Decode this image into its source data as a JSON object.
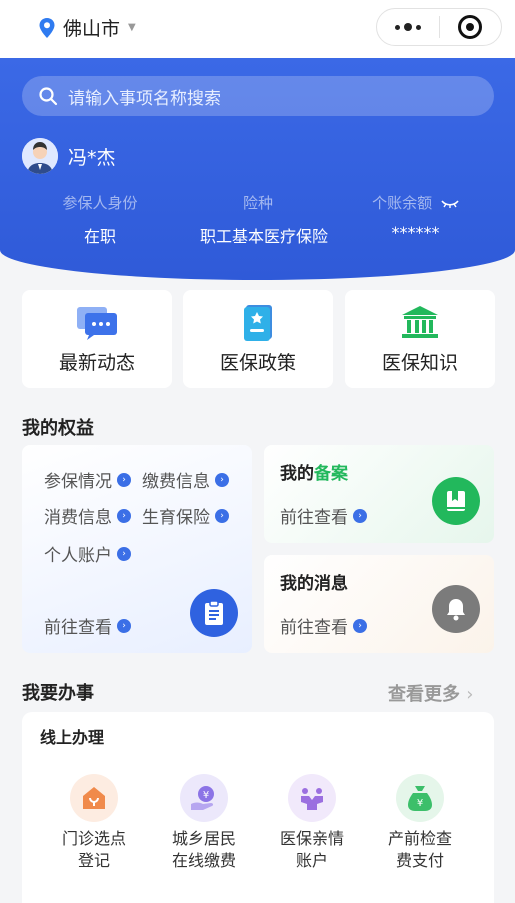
{
  "location": {
    "city": "佛山市"
  },
  "search": {
    "placeholder": "请输入事项名称搜索"
  },
  "user": {
    "name": "冯*杰"
  },
  "stats": [
    {
      "label": "参保人身份",
      "value": "在职"
    },
    {
      "label": "险种",
      "value": "职工基本医疗保险"
    },
    {
      "label": "个账余额",
      "value": "******"
    }
  ],
  "quick": [
    {
      "label": "最新动态",
      "icon": "chat-icon"
    },
    {
      "label": "医保政策",
      "icon": "document-icon"
    },
    {
      "label": "医保知识",
      "icon": "bank-icon"
    }
  ],
  "rights": {
    "title": "我的权益",
    "links": [
      "参保情况",
      "缴费信息",
      "消费信息",
      "生育保险",
      "个人账户"
    ],
    "go": "前往查看"
  },
  "filing": {
    "title_prefix": "我的",
    "title_highlight": "备案",
    "go": "前往查看"
  },
  "messages": {
    "title": "我的消息",
    "go": "前往查看"
  },
  "tasks": {
    "title": "我要办事",
    "more": "查看更多",
    "sub": "线上办理",
    "items": [
      {
        "label": "门诊选点\n登记"
      },
      {
        "label": "城乡居民\n在线缴费"
      },
      {
        "label": "医保亲情\n账户"
      },
      {
        "label": "产前检查\n费支付"
      }
    ]
  },
  "colors": {
    "primary": "#2f5ad8",
    "green": "#22b85c"
  }
}
